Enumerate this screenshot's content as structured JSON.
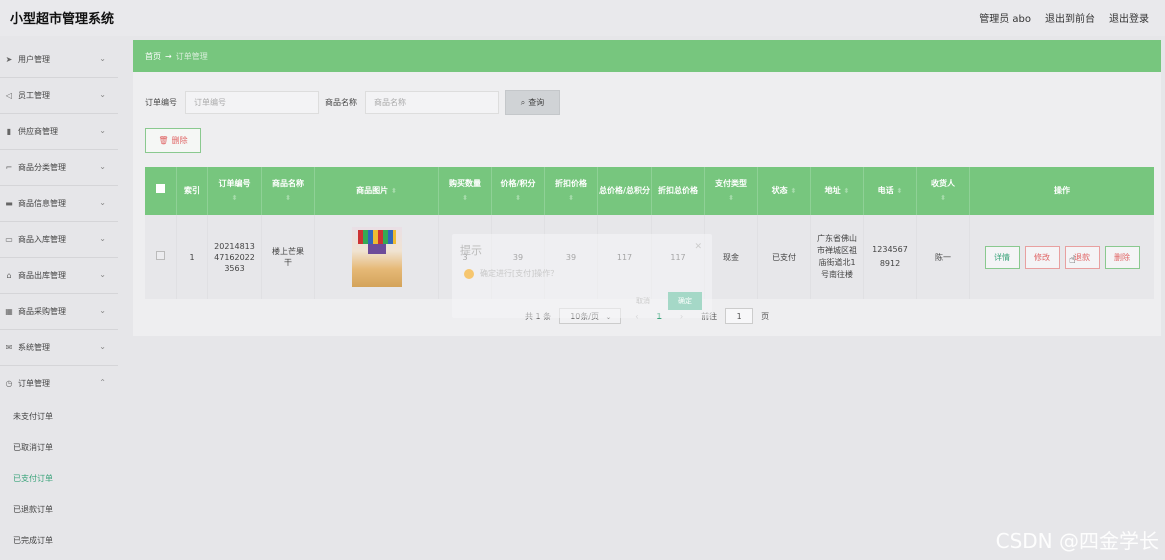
{
  "app": {
    "title": "小型超市管理系统"
  },
  "topbar": {
    "admin": "管理员 abo",
    "front": "退出到前台",
    "logout": "退出登录"
  },
  "sidebar": {
    "items": [
      {
        "label": "用户管理",
        "icon": "send-icon"
      },
      {
        "label": "员工管理",
        "icon": "location-icon"
      },
      {
        "label": "供应商管理",
        "icon": "clipboard-icon"
      },
      {
        "label": "商品分类管理",
        "icon": "crop-icon"
      },
      {
        "label": "商品信息管理",
        "icon": "chat-icon"
      },
      {
        "label": "商品入库管理",
        "icon": "printer-icon"
      },
      {
        "label": "商品出库管理",
        "icon": "bank-icon"
      },
      {
        "label": "商品采购管理",
        "icon": "grid-icon"
      },
      {
        "label": "系统管理",
        "icon": "message-icon"
      },
      {
        "label": "订单管理",
        "icon": "clock-icon"
      }
    ],
    "order_sub": [
      "未支付订单",
      "已取消订单",
      "已支付订单",
      "已退款订单",
      "已完成订单"
    ],
    "active_sub": "已支付订单"
  },
  "breadcrumb": {
    "home": "首页",
    "arrow": "→",
    "current": "订单管理"
  },
  "search": {
    "order_label": "订单编号",
    "order_placeholder": "订单编号",
    "name_label": "商品名称",
    "name_placeholder": "商品名称",
    "query_button": "查询"
  },
  "toolbar": {
    "delete_label": "删除"
  },
  "table": {
    "headers": [
      "索引",
      "订单编号",
      "商品名称",
      "商品图片",
      "购买数量",
      "价格/积分",
      "折扣价格",
      "总价格/总积分",
      "折扣总价格",
      "支付类型",
      "状态",
      "地址",
      "电话",
      "收货人",
      "操作"
    ],
    "row": {
      "index": "1",
      "order_no": "20214813471620223563",
      "name": "楼上芒果干",
      "qty": "3",
      "price": "39",
      "discount": "39",
      "total": "117",
      "discount_total": "117",
      "pay_type": "现金",
      "status": "已支付",
      "address": "广东省佛山市禅城区祖庙街道北1号南往楼",
      "phone": "12345678912",
      "receiver": "陈一"
    },
    "ops": {
      "detail": "详情",
      "edit": "修改",
      "refund": "退款",
      "delete": "删除"
    }
  },
  "pager": {
    "total": "共 1 条",
    "size": "10条/页",
    "page": "1",
    "goto": "前往",
    "goto_val": "1",
    "unit": "页"
  },
  "dialog": {
    "title": "提示",
    "message": "确定进行[支付]操作？",
    "cancel": "取消",
    "confirm": "确定"
  },
  "watermark": "CSDN @四金学长",
  "colors": {
    "primary": "#77c67e",
    "accent": "#3aa37a",
    "danger": "#e06565"
  }
}
